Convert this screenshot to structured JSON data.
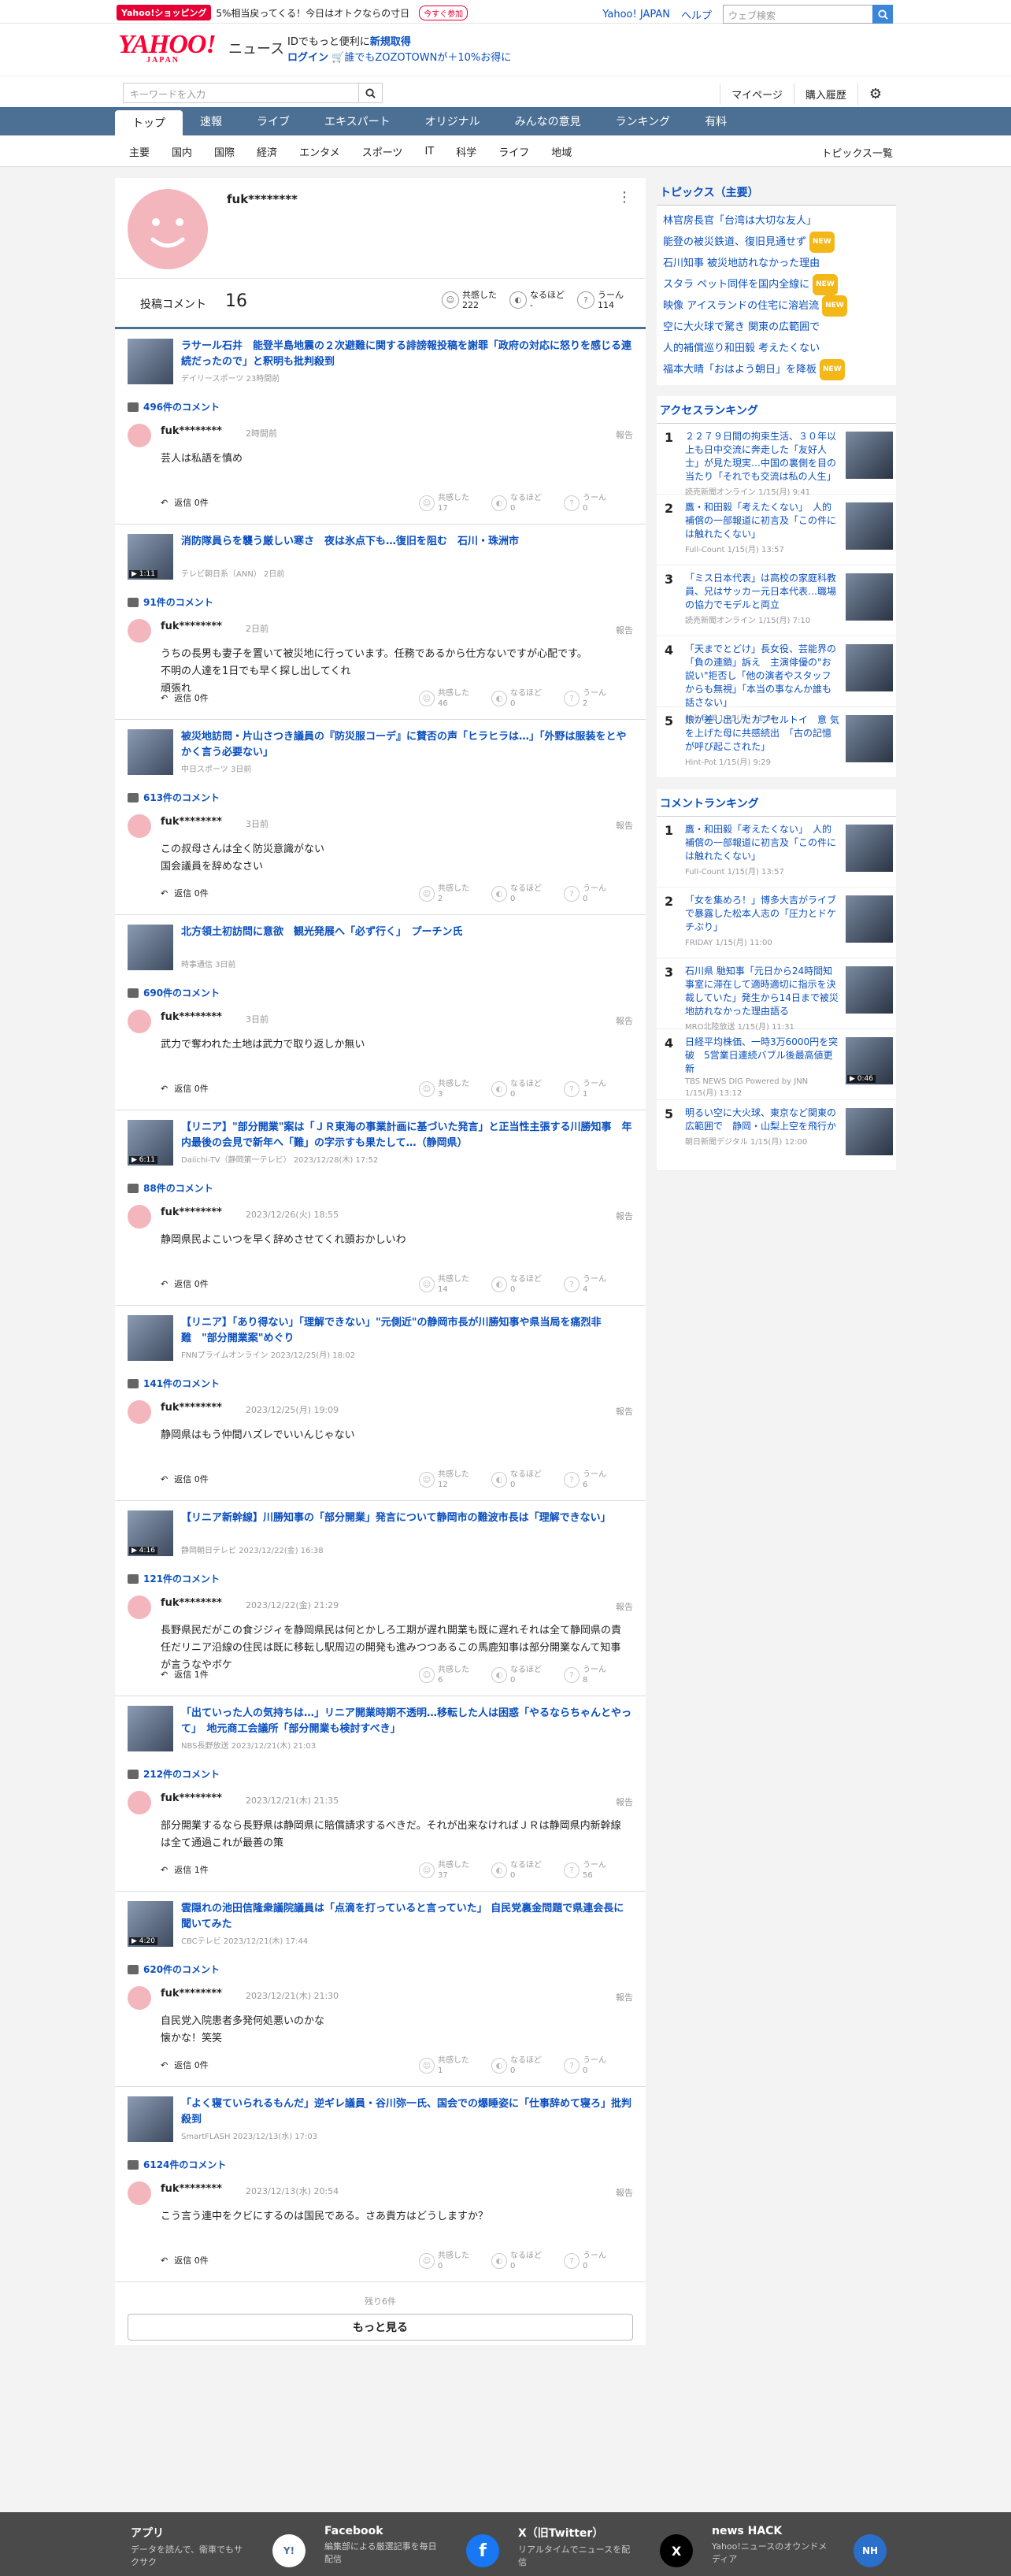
{
  "topbar": {
    "shop_badge": "Yahoo!ショッピング",
    "shop_text": "5%相当戻ってくる！今日はオトクならの寸日",
    "shop_btn": "今すぐ参加",
    "links": [
      "Yahoo! JAPAN",
      "ヘルプ"
    ],
    "web_search_placeholder": "ウェブ検索"
  },
  "header": {
    "logo": "YAHOO!",
    "logo_sub": "JAPAN",
    "section": "ニュース",
    "id_line1": "IDでもっと便利に",
    "id_new": "新規取得",
    "login": "ログイン",
    "id_line2": "誰でもZOZOTOWNが＋10%お得に"
  },
  "search": {
    "placeholder": "キーワードを入力",
    "links": [
      "マイページ",
      "購入履歴"
    ]
  },
  "nav": [
    "トップ",
    "速報",
    "ライブ",
    "エキスパート",
    "オリジナル",
    "みんなの意見",
    "ランキング",
    "有料"
  ],
  "subnav": [
    "主要",
    "国内",
    "国際",
    "経済",
    "エンタメ",
    "スポーツ",
    "IT",
    "科学",
    "ライフ",
    "地域"
  ],
  "subnav_all": "トピックス一覧",
  "profile": {
    "name": "fuk********",
    "comment_label": "投稿コメント",
    "comment_count": "16",
    "reactions": [
      {
        "label": "共感した",
        "value": "222"
      },
      {
        "label": "なるほど",
        "value": "-"
      },
      {
        "label": "うーん",
        "value": "114"
      }
    ]
  },
  "items": [
    {
      "title": "ラサール石井　能登半島地震の２次避難に関する誹謗報投稿を謝罪「政府の対応に怒りを感じる連続だったので」と釈明も批判殺到",
      "source": "デイリースポーツ 23時間前",
      "ccount": "496件のコメント",
      "user": "fuk********",
      "time": "2時間前",
      "text": "芸人は私語を慎め",
      "replies": "返信 0件",
      "r": [
        "17",
        "0",
        "0"
      ],
      "play": ""
    },
    {
      "title": "消防隊員らを襲う厳しい寒さ　夜は氷点下も…復旧を阻む　石川・珠洲市",
      "source": "テレビ朝日系（ANN） 2日前",
      "ccount": "91件のコメント",
      "user": "fuk********",
      "time": "2日前",
      "text": "うちの長男も妻子を置いて被災地に行っています。任務であるから仕方ないですが心配です。\n不明の人達を1日でも早く探し出してくれ\n頑張れ",
      "replies": "返信 0件",
      "r": [
        "46",
        "0",
        "2"
      ],
      "play": "▶ 1:11"
    },
    {
      "title": "被災地訪問・片山さつき議員の『防災服コーデ』に賛否の声「ヒラヒラは…」「外野は服装をとやかく言う必要ない」",
      "source": "中日スポーツ 3日前",
      "ccount": "613件のコメント",
      "user": "fuk********",
      "time": "3日前",
      "text": "この叔母さんは全く防災意識がない\n国会議員を辞めなさい",
      "replies": "返信 0件",
      "r": [
        "2",
        "0",
        "0"
      ],
      "play": ""
    },
    {
      "title": "北方領土初訪問に意欲　観光発展へ「必ず行く」　プーチン氏",
      "source": "時事通信 3日前",
      "ccount": "690件のコメント",
      "user": "fuk********",
      "time": "3日前",
      "text": "武力で奪われた土地は武力で取り返しか無い",
      "replies": "返信 0件",
      "r": [
        "3",
        "0",
        "1"
      ],
      "play": ""
    },
    {
      "title": "【リニア】\"部分開業\"案は「ＪＲ東海の事業計画に基づいた発言」と正当性主張する川勝知事　年内最後の会見で新年へ「難」の字示すも果たして…（静岡県）",
      "source": "Daiichi-TV（静岡第一テレビ） 2023/12/28(木) 17:52",
      "ccount": "88件のコメント",
      "user": "fuk********",
      "time": "2023/12/26(火) 18:55",
      "text": "静岡県民よこいつを早く辞めさせてくれ頭おかしいわ",
      "replies": "返信 0件",
      "r": [
        "14",
        "0",
        "4"
      ],
      "play": "▶ 6:11"
    },
    {
      "title": "【リニア】「あり得ない」「理解できない」\"元側近\"の静岡市長が川勝知事や県当局を痛烈非難　\"部分開業案\"めぐり",
      "source": "FNNプライムオンライン 2023/12/25(月) 18:02",
      "ccount": "141件のコメント",
      "user": "fuk********",
      "time": "2023/12/25(月) 19:09",
      "text": "静岡県はもう仲間ハズレでいいんじゃない",
      "replies": "返信 0件",
      "r": [
        "12",
        "0",
        "6"
      ],
      "play": ""
    },
    {
      "title": "【リニア新幹線】川勝知事の「部分開業」発言について静岡市の難波市長は「理解できない」",
      "source": "静岡朝日テレビ 2023/12/22(金) 16:38",
      "ccount": "121件のコメント",
      "user": "fuk********",
      "time": "2023/12/22(金) 21:29",
      "text": "長野県民だがこの食ジジィを静岡県民は何とかしろ工期が遅れ開業も既に遅れそれは全て静岡県の責任だリニア沿線の住民は既に移転し駅周辺の開発も進みつつあるこの馬鹿知事は部分開業なんて知事が言うなやボケ",
      "replies": "返信 1件",
      "r": [
        "6",
        "0",
        "8"
      ],
      "play": "▶ 4:16"
    },
    {
      "title": "「出ていった人の気持ちは…」リニア開業時期不透明…移転した人は困惑「やるならちゃんとやって」　地元商工会議所「部分開業も検討すべき」",
      "source": "NBS長野放送 2023/12/21(木) 21:03",
      "ccount": "212件のコメント",
      "user": "fuk********",
      "time": "2023/12/21(木) 21:35",
      "text": "部分開業するなら長野県は静岡県に賠償請求するべきだ。それが出来なければＪＲは静岡県内新幹線は全て通過これが最善の策",
      "replies": "返信 1件",
      "r": [
        "37",
        "0",
        "56"
      ],
      "play": ""
    },
    {
      "title": "雲隠れの池田信隆衆議院議員は「点滴を打っていると言っていた」 自民党裏金問題で県連会長に聞いてみた",
      "source": "CBCテレビ 2023/12/21(木) 17:44",
      "ccount": "620件のコメント",
      "user": "fuk********",
      "time": "2023/12/21(木) 21:30",
      "text": "自民党入院患者多発何処悪いのかな\n懐かな！笑笑",
      "replies": "返信 0件",
      "r": [
        "1",
        "0",
        "0"
      ],
      "play": "▶ 4:20"
    },
    {
      "title": "「よく寝ていられるもんだ」逆ギレ議員・谷川弥一氏、国会での爆睡姿に「仕事辞めて寝ろ」批判殺到",
      "source": "SmartFLASH 2023/12/13(水) 17:03",
      "ccount": "6124件のコメント",
      "user": "fuk********",
      "time": "2023/12/13(水) 20:54",
      "text": "こう言う連中をクビにするのは国民である。さあ貴方はどうしますか？",
      "replies": "返信 0件",
      "r": [
        "0",
        "0",
        "0"
      ],
      "play": ""
    }
  ],
  "reaction_labels": [
    "共感した",
    "なるほど",
    "うーん"
  ],
  "report_label": "報告",
  "more": {
    "remain": "残り6件",
    "button": "もっと見る"
  },
  "side": {
    "topics_title": "トピックス（主要）",
    "topics": [
      {
        "text": "林官房長官「台湾は大切な友人」",
        "badge": ""
      },
      {
        "text": "能登の被災鉄道、復旧見通せず",
        "badge": "NEW"
      },
      {
        "text": "石川知事 被災地訪れなかった理由",
        "badge": ""
      },
      {
        "text": "スタラ ペット同伴を国内全線に",
        "badge": "NEW"
      },
      {
        "text": "映像 アイスランドの住宅に溶岩流",
        "badge": "NEW"
      },
      {
        "text": "空に大火球で驚き 関東の広範囲で",
        "badge": ""
      },
      {
        "text": "人的補償巡り和田毅 考えたくない",
        "badge": ""
      },
      {
        "text": "福本大晴「おはよう朝日」を降板",
        "badge": "NEW"
      }
    ],
    "access_title": "アクセスランキング",
    "access": [
      {
        "no": "1",
        "title": "２２７９日間の拘束生活、３０年以上も日中交流に奔走した「友好人士」が見た現実…中国の裏側を目の当たり「それでも交流は私の人生」",
        "src": "読売新聞オンライン 1/15(月) 9:41"
      },
      {
        "no": "2",
        "title": "鷹・和田毅「考えたくない」　人的補償の一部報道に初言及「この件には触れたくない」",
        "src": "Full-Count 1/15(月) 13:57"
      },
      {
        "no": "3",
        "title": "「ミス日本代表」は高校の家庭科教員、兄はサッカー元日本代表…職場の協力でモデルと両立",
        "src": "読売新聞オンライン 1/15(月) 7:10"
      },
      {
        "no": "4",
        "title": "「天までとどけ」長女役、芸能界の「負の連鎖」訴え　主演俳優の\"お説い\"拒否し「他の演者やスタッフからも無視」「本当の事なんか誰も話さない」",
        "src": "ねとらぼ 1/15(月) 11:30"
      },
      {
        "no": "5",
        "title": "娘が差し出したカプセルトイ　意 気を上げた母に共感続出　「古の記憶が呼び起こされた」",
        "src": "Hint-Pot 1/15(月) 9:29"
      }
    ],
    "comment_title": "コメントランキング",
    "comment_rank": [
      {
        "no": "1",
        "title": "鷹・和田毅「考えたくない」　人的補償の一部報道に初言及「この件には触れたくない」",
        "src": "Full-Count 1/15(月) 13:57",
        "play": ""
      },
      {
        "no": "2",
        "title": "「女を集めろ！」博多大吉がライブで暴露した松本人志の「圧力とドケチぶり」",
        "src": "FRIDAY 1/15(月) 11:00",
        "play": ""
      },
      {
        "no": "3",
        "title": "石川県 馳知事「元日から24時間知事室に滞在して適時適切に指示を決裁していた」発生から14日まで被災地訪れなかった理由語る",
        "src": "MRO北陸放送 1/15(月) 11:31",
        "play": ""
      },
      {
        "no": "4",
        "title": "日経平均株価、一時3万6000円を突破　5営業日連続バブル後最高値更新",
        "src": "TBS NEWS DIG Powered by JNN 1/15(月) 13:12",
        "play": "▶ 0:46"
      },
      {
        "no": "5",
        "title": "明るい空に大火球、東京など関東の広範囲で　静岡・山梨上空を飛行か",
        "src": "朝日新聞デジタル 1/15(月) 12:00",
        "play": ""
      }
    ]
  },
  "footer": [
    {
      "title": "アプリ",
      "desc": "データを読んで、衛車でもサクサク",
      "icon": "Y!"
    },
    {
      "title": "Facebook",
      "desc": "編集部による厳選記事を毎日配信",
      "icon": "f"
    },
    {
      "title": "X（旧Twitter）",
      "desc": "リアルタイムでニュースを配信",
      "icon": "X"
    },
    {
      "title": "news HACK",
      "desc": "Yahoo!ニュースのオウンドメディア",
      "icon": "NH"
    }
  ]
}
